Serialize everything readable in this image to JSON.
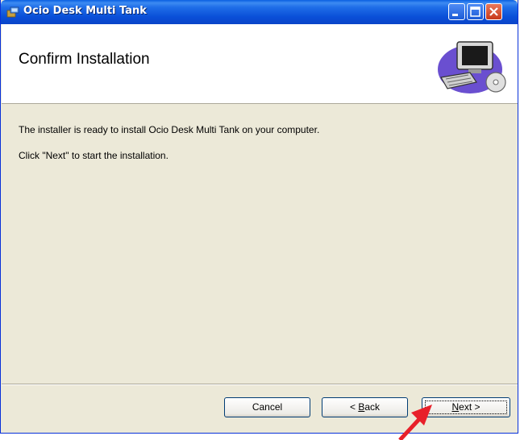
{
  "window": {
    "title": "Ocio Desk Multi Tank",
    "controls": {
      "minimize": "minimize-button",
      "maximize": "maximize-button",
      "close": "close-button"
    }
  },
  "header": {
    "title": "Confirm Installation",
    "illustration": "computer-installer-icon"
  },
  "body": {
    "line1": "The installer is ready to install Ocio Desk Multi Tank on your computer.",
    "line2": "Click \"Next\" to start the installation."
  },
  "buttons": {
    "cancel": "Cancel",
    "back_prefix": "< ",
    "back_mnemonic": "B",
    "back_rest": "ack",
    "next_mnemonic": "N",
    "next_rest": "ext >"
  },
  "colors": {
    "titlebar": "#0a4fd8",
    "dialog_bg": "#ece9d8",
    "annotation_arrow": "#e8202a"
  }
}
